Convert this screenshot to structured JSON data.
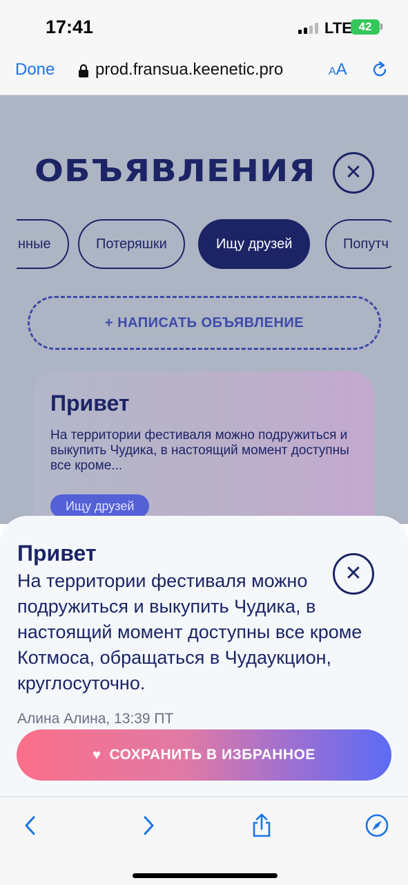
{
  "status_bar": {
    "time": "17:41",
    "network": "LTE",
    "battery": "42"
  },
  "browser": {
    "done_label": "Done",
    "url": "prod.fransua.keenetic.pro",
    "text_size_label": "AA",
    "accent_color": "#1a73e8"
  },
  "page": {
    "title": "ОБЪЯВЛЕНИЯ",
    "tabs": [
      {
        "label": "...нные"
      },
      {
        "label": "Потеряшки"
      },
      {
        "label": "Ищу друзей",
        "active": true
      },
      {
        "label": "Попутч..."
      }
    ],
    "write_button": "+ НАПИСАТЬ ОБЪЯВЛЕНИЕ",
    "card": {
      "title": "Привет",
      "text": "На территории фестиваля можно подружиться и выкупить Чудика, в настоящий момент доступны все кроме...",
      "tag": "Ищу друзей"
    }
  },
  "sheet": {
    "title": "Привет",
    "text": "На территории фестиваля можно подружиться и выкупить Чудика, в настоящий момент доступны все кроме Котмоса, обращаться в Чудаукцион, круглосуточно.",
    "meta": "Алина Алина, 13:39 ПТ",
    "save_button": "СОХРАНИТЬ В ИЗБРАННОЕ"
  },
  "colors": {
    "brand_dark": "#1c2466",
    "accent_blue": "#3e4aa8",
    "gradient_start": "#fb6f8a",
    "gradient_end": "#5b6cf5"
  }
}
